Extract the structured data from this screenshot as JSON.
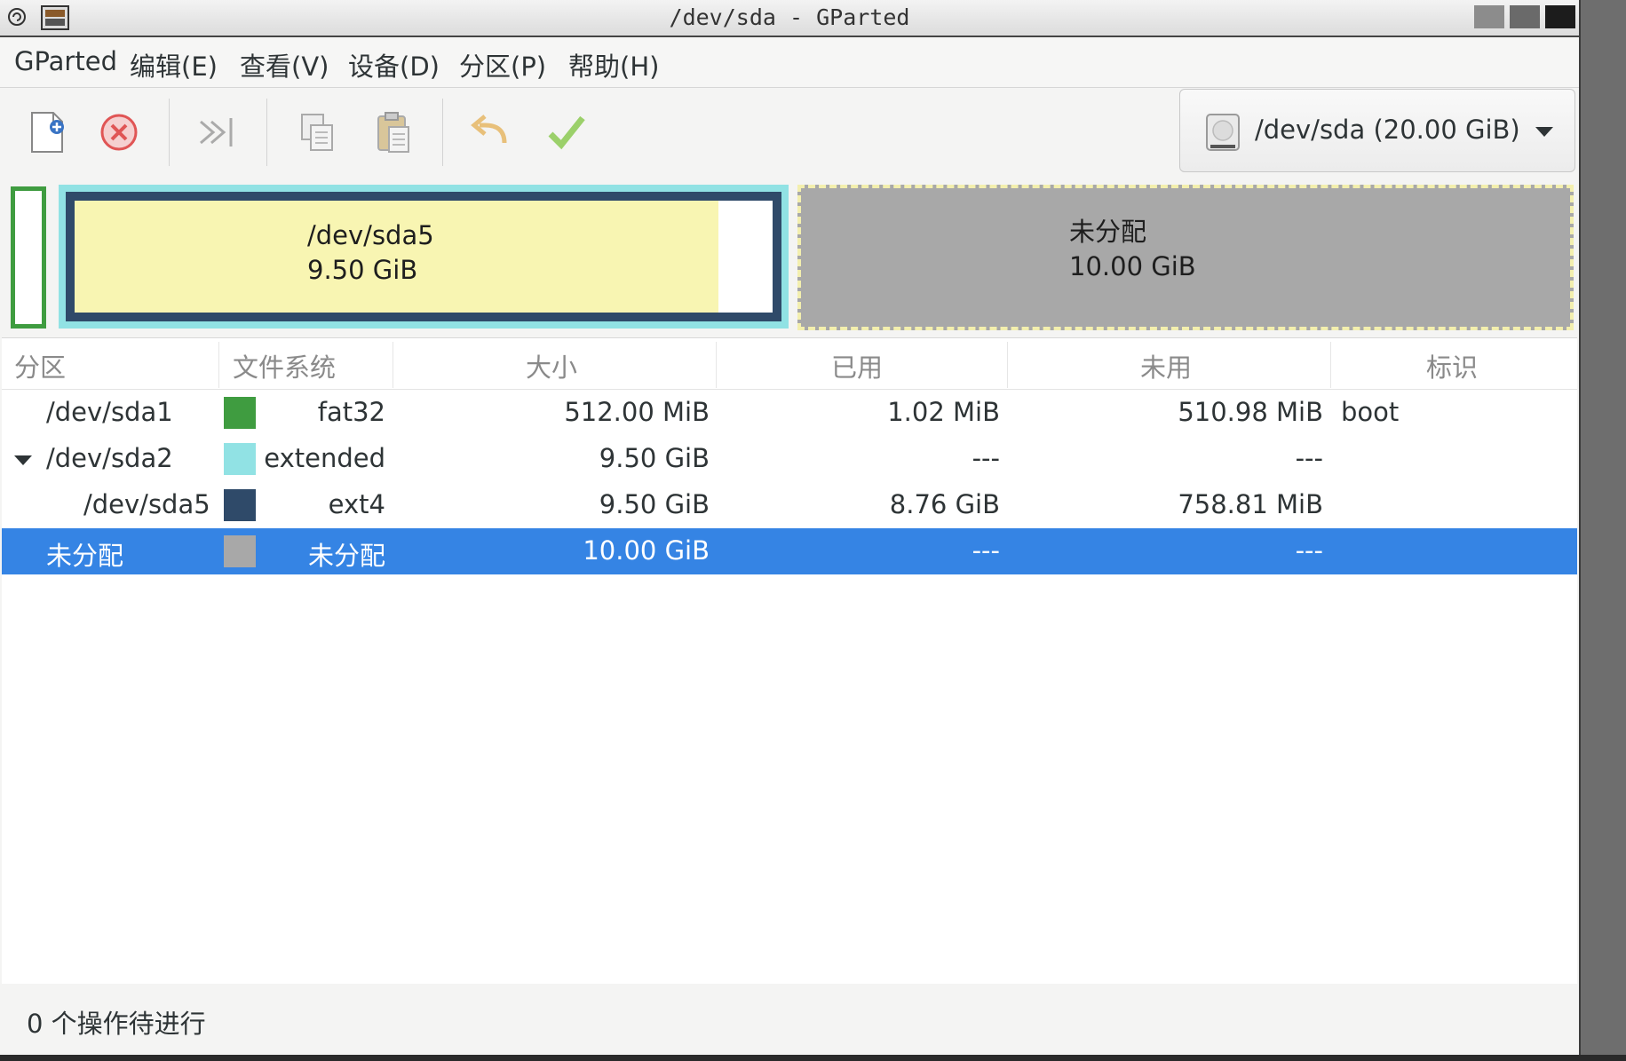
{
  "window": {
    "title": "/dev/sda - GParted"
  },
  "menu": {
    "items": [
      "GParted",
      "编辑(E)",
      "查看(V)",
      "设备(D)",
      "分区(P)",
      "帮助(H)"
    ]
  },
  "toolbar": {
    "tools": [
      "new-icon",
      "delete-icon",
      "resize-move-icon",
      "copy-icon",
      "paste-icon",
      "undo-icon",
      "apply-icon"
    ],
    "device_label": "/dev/sda (20.00 GiB)"
  },
  "diskmap": {
    "sda5": {
      "name": "/dev/sda5",
      "size": "9.50 GiB",
      "used_fraction": 0.922
    },
    "unallocated": {
      "name": "未分配",
      "size": "10.00 GiB"
    }
  },
  "table": {
    "headers": [
      "分区",
      "文件系统",
      "大小",
      "已用",
      "未用",
      "标识"
    ],
    "rows": [
      {
        "partition": "/dev/sda1",
        "filesystem": "fat32",
        "size": "512.00 MiB",
        "used": "1.02 MiB",
        "unused": "510.98 MiB",
        "flags": "boot",
        "color": "#3f9c40"
      },
      {
        "partition": "/dev/sda2",
        "filesystem": "extended",
        "size": "9.50 GiB",
        "used": "---",
        "unused": "---",
        "flags": "",
        "color": "#91e2e4"
      },
      {
        "partition": "/dev/sda5",
        "filesystem": "ext4",
        "size": "9.50 GiB",
        "used": "8.76 GiB",
        "unused": "758.81 MiB",
        "flags": "",
        "color": "#2f4a69"
      },
      {
        "partition": "未分配",
        "filesystem": "未分配",
        "size": "10.00 GiB",
        "used": "---",
        "unused": "---",
        "flags": "",
        "color": "#a8a8a8"
      }
    ]
  },
  "status": {
    "text": "0 个操作待进行"
  },
  "colors": {
    "selection": "#3584e4"
  }
}
